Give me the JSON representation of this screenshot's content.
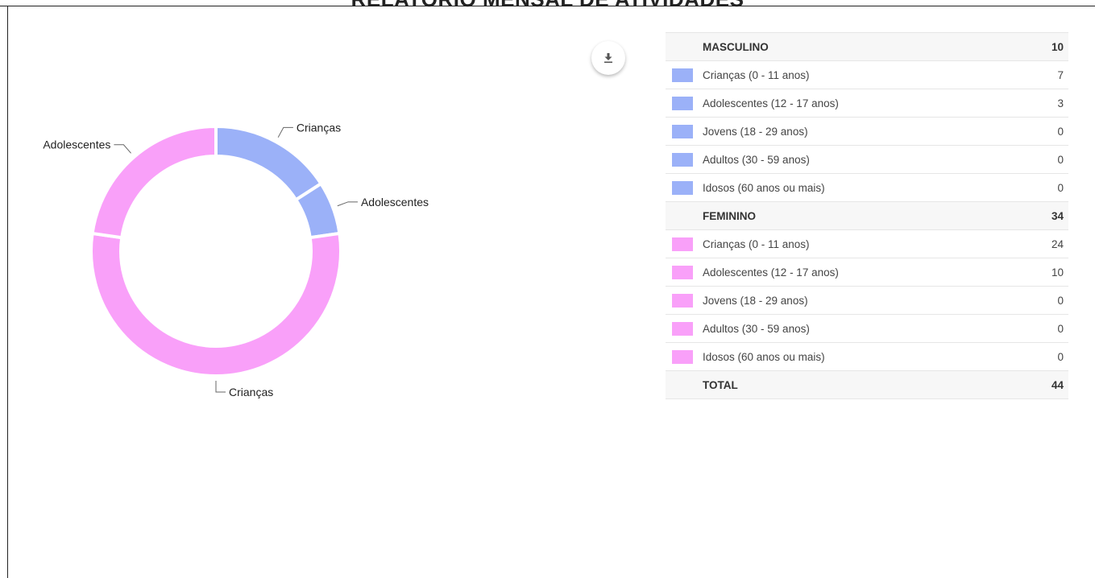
{
  "title": "RELATÓRIO MENSAL DE ATIVIDADES",
  "download_icon": "download-icon",
  "colors": {
    "masculino": "#9bb1f8",
    "feminino": "#f9a0f9"
  },
  "chart_data": {
    "type": "pie",
    "variant": "donut",
    "slices": [
      {
        "label": "Crianças",
        "group": "MASCULINO",
        "value": 7,
        "color": "#9bb1f8"
      },
      {
        "label": "Adolescentes",
        "group": "MASCULINO",
        "value": 3,
        "color": "#9bb1f8"
      },
      {
        "label": "Crianças",
        "group": "FEMININO",
        "value": 24,
        "color": "#f9a0f9"
      },
      {
        "label": "Adolescentes",
        "group": "FEMININO",
        "value": 10,
        "color": "#f9a0f9"
      }
    ],
    "total": 44
  },
  "table": {
    "groups": [
      {
        "name": "MASCULINO",
        "total": "10",
        "color": "#9bb1f8",
        "rows": [
          {
            "label": "Crianças (0 - 11 anos)",
            "value": "7"
          },
          {
            "label": "Adolescentes (12 - 17 anos)",
            "value": "3"
          },
          {
            "label": "Jovens (18 - 29 anos)",
            "value": "0"
          },
          {
            "label": "Adultos (30 - 59 anos)",
            "value": "0"
          },
          {
            "label": "Idosos (60 anos ou mais)",
            "value": "0"
          }
        ]
      },
      {
        "name": "FEMININO",
        "total": "34",
        "color": "#f9a0f9",
        "rows": [
          {
            "label": "Crianças (0 - 11 anos)",
            "value": "24"
          },
          {
            "label": "Adolescentes (12 - 17 anos)",
            "value": "10"
          },
          {
            "label": "Jovens (18 - 29 anos)",
            "value": "0"
          },
          {
            "label": "Adultos (30 - 59 anos)",
            "value": "0"
          },
          {
            "label": "Idosos (60 anos ou mais)",
            "value": "0"
          }
        ]
      }
    ],
    "total_label": "TOTAL",
    "total_value": "44"
  }
}
